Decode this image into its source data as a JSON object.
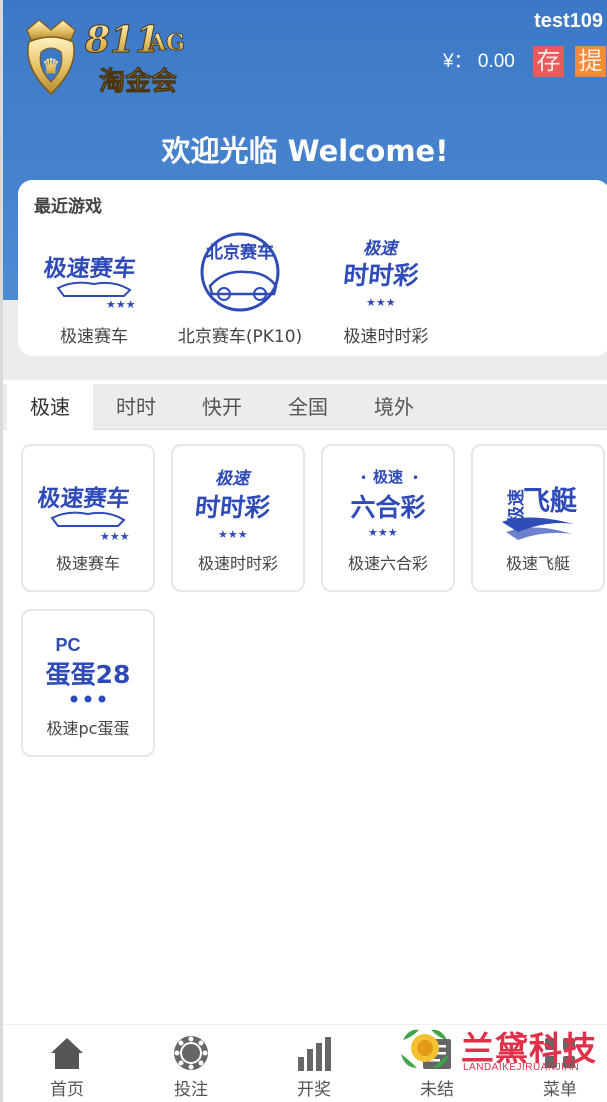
{
  "header": {
    "brand_number": "811",
    "brand_badge": "AG",
    "brand_name": "淘金会",
    "username": "test109",
    "balance": "¥： 0.00",
    "deposit_label": "存",
    "withdraw_label": "提",
    "welcome": "欢迎光临 Welcome!"
  },
  "recent": {
    "title": "最近游戏",
    "items": [
      {
        "label": "极速赛车",
        "icon": "speed-racing-logo"
      },
      {
        "label": "北京赛车(PK10)",
        "icon": "beijing-racing-logo"
      },
      {
        "label": "极速时时彩",
        "icon": "speed-lottery-logo"
      }
    ]
  },
  "tabs": [
    {
      "label": "极速",
      "active": true
    },
    {
      "label": "时时",
      "active": false
    },
    {
      "label": "快开",
      "active": false
    },
    {
      "label": "全国",
      "active": false
    },
    {
      "label": "境外",
      "active": false
    }
  ],
  "games": [
    {
      "label": "极速赛车",
      "icon": "speed-racing-logo"
    },
    {
      "label": "极速时时彩",
      "icon": "speed-lottery-logo"
    },
    {
      "label": "极速六合彩",
      "icon": "speed-six-logo"
    },
    {
      "label": "极速飞艇",
      "icon": "speed-boat-logo"
    },
    {
      "label": "极速pc蛋蛋",
      "icon": "pc-eggs-logo"
    }
  ],
  "logo_text": {
    "speed": "极速",
    "racing": "极速赛车",
    "beijing": "北京赛车",
    "lottery": "时时彩",
    "six": "六合彩",
    "boat_a": "极速",
    "boat_b": "飞艇",
    "pc": "PC",
    "eggs": "蛋蛋28"
  },
  "bottom_nav": [
    {
      "label": "首页",
      "icon": "home-icon"
    },
    {
      "label": "投注",
      "icon": "chip-icon"
    },
    {
      "label": "开奖",
      "icon": "bar-chart-icon"
    },
    {
      "label": "未结",
      "icon": "pending-icon"
    },
    {
      "label": "菜单",
      "icon": "menu-icon"
    }
  ],
  "watermark": {
    "cn": "兰黛科技",
    "en": "LANDAIKEJIRUANJIAN"
  },
  "colors": {
    "header_blue": "#3c78c5",
    "logo_blue": "#2f4bb8",
    "deposit_red": "#e95a5a",
    "withdraw_orange": "#f08a3c",
    "watermark_red": "#e0304a"
  }
}
